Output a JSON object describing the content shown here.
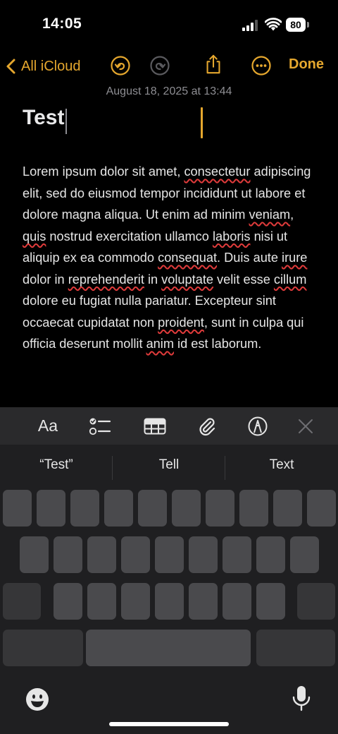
{
  "status_bar": {
    "time": "14:05",
    "battery": "80"
  },
  "nav": {
    "back_label": "All iCloud",
    "done_label": "Done",
    "accent_color": "#E5A72E",
    "icons": [
      "chevron-left-icon",
      "undo-icon",
      "redo-icon",
      "share-icon",
      "more-icon"
    ]
  },
  "note": {
    "date": "August 18, 2025 at 13:44",
    "title": "Test",
    "body": [
      {
        "t": "Lorem ipsum dolor sit amet, "
      },
      {
        "t": "consectetur",
        "spell": true
      },
      {
        "t": " adipiscing elit, sed do eiusmod tempor incididunt ut labore et dolore magna aliqua. Ut enim ad minim "
      },
      {
        "t": "veniam",
        "spell": true
      },
      {
        "t": ", "
      },
      {
        "t": "quis",
        "spell": true
      },
      {
        "t": " nostrud exercitation ullamco "
      },
      {
        "t": "laboris",
        "spell": true
      },
      {
        "t": " nisi ut aliquip ex ea commodo "
      },
      {
        "t": "consequat",
        "spell": true
      },
      {
        "t": ". Duis aute "
      },
      {
        "t": "irure",
        "spell": true
      },
      {
        "t": " dolor in "
      },
      {
        "t": "reprehenderit",
        "spell": true
      },
      {
        "t": " in "
      },
      {
        "t": "voluptate",
        "spell": true
      },
      {
        "t": " velit esse "
      },
      {
        "t": "cillum",
        "spell": true
      },
      {
        "t": " dolore eu fugiat nulla pariatur. Excepteur sint occaecat cupidatat non "
      },
      {
        "t": "proident",
        "spell": true
      },
      {
        "t": ", sunt in culpa qui officia deserunt mollit "
      },
      {
        "t": "anim",
        "spell": true
      },
      {
        "t": " id est laborum."
      }
    ]
  },
  "toolbar": {
    "format_label": "Aa",
    "icons": [
      "checklist-icon",
      "table-icon",
      "attachment-icon",
      "markup-icon",
      "close-icon"
    ]
  },
  "suggestions": [
    "“Test”",
    "Tell",
    "Text"
  ]
}
